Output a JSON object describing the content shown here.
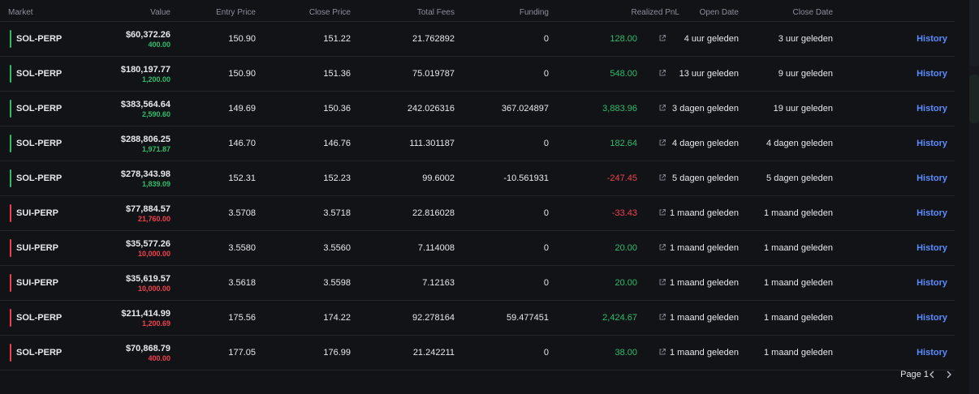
{
  "headers": {
    "market": "Market",
    "value": "Value",
    "entry": "Entry Price",
    "close": "Close Price",
    "fees": "Total Fees",
    "funding": "Funding",
    "pnl": "Realized PnL",
    "open_date": "Open Date",
    "close_date": "Close Date"
  },
  "colors": {
    "positive": "#2fbd6b",
    "negative": "#f0414c",
    "link": "#5b8cff"
  },
  "icons": {
    "external": "external-link-icon",
    "prev": "chevron-left-icon",
    "next": "chevron-right-icon"
  },
  "rows": [
    {
      "market": "SOL-PERP",
      "side": "long",
      "value": "$60,372.26",
      "size": "400.00",
      "entry": "150.90",
      "close": "151.22",
      "fees": "21.762892",
      "funding": "0",
      "pnl": "128.00",
      "pnl_sign": "pos",
      "open_date": "4 uur geleden",
      "close_date": "3 uur geleden",
      "action": "History"
    },
    {
      "market": "SOL-PERP",
      "side": "long",
      "value": "$180,197.77",
      "size": "1,200.00",
      "entry": "150.90",
      "close": "151.36",
      "fees": "75.019787",
      "funding": "0",
      "pnl": "548.00",
      "pnl_sign": "pos",
      "open_date": "13 uur geleden",
      "close_date": "9 uur geleden",
      "action": "History"
    },
    {
      "market": "SOL-PERP",
      "side": "long",
      "value": "$383,564.64",
      "size": "2,590.60",
      "entry": "149.69",
      "close": "150.36",
      "fees": "242.026316",
      "funding": "367.024897",
      "pnl": "3,883.96",
      "pnl_sign": "pos",
      "open_date": "3 dagen geleden",
      "close_date": "19 uur geleden",
      "action": "History"
    },
    {
      "market": "SOL-PERP",
      "side": "long",
      "value": "$288,806.25",
      "size": "1,971.87",
      "entry": "146.70",
      "close": "146.76",
      "fees": "111.301187",
      "funding": "0",
      "pnl": "182.64",
      "pnl_sign": "pos",
      "open_date": "4 dagen geleden",
      "close_date": "4 dagen geleden",
      "action": "History"
    },
    {
      "market": "SOL-PERP",
      "side": "long",
      "value": "$278,343.98",
      "size": "1,839.09",
      "entry": "152.31",
      "close": "152.23",
      "fees": "99.6002",
      "funding": "-10.561931",
      "pnl": "-247.45",
      "pnl_sign": "neg",
      "open_date": "5 dagen geleden",
      "close_date": "5 dagen geleden",
      "action": "History"
    },
    {
      "market": "SUI-PERP",
      "side": "short",
      "value": "$77,884.57",
      "size": "21,760.00",
      "entry": "3.5708",
      "close": "3.5718",
      "fees": "22.816028",
      "funding": "0",
      "pnl": "-33.43",
      "pnl_sign": "neg",
      "open_date": "1 maand geleden",
      "close_date": "1 maand geleden",
      "action": "History"
    },
    {
      "market": "SUI-PERP",
      "side": "short",
      "value": "$35,577.26",
      "size": "10,000.00",
      "entry": "3.5580",
      "close": "3.5560",
      "fees": "7.114008",
      "funding": "0",
      "pnl": "20.00",
      "pnl_sign": "pos",
      "open_date": "1 maand geleden",
      "close_date": "1 maand geleden",
      "action": "History"
    },
    {
      "market": "SUI-PERP",
      "side": "short",
      "value": "$35,619.57",
      "size": "10,000.00",
      "entry": "3.5618",
      "close": "3.5598",
      "fees": "7.12163",
      "funding": "0",
      "pnl": "20.00",
      "pnl_sign": "pos",
      "open_date": "1 maand geleden",
      "close_date": "1 maand geleden",
      "action": "History"
    },
    {
      "market": "SOL-PERP",
      "side": "short",
      "value": "$211,414.99",
      "size": "1,200.69",
      "entry": "175.56",
      "close": "174.22",
      "fees": "92.278164",
      "funding": "59.477451",
      "pnl": "2,424.67",
      "pnl_sign": "pos",
      "open_date": "1 maand geleden",
      "close_date": "1 maand geleden",
      "action": "History"
    },
    {
      "market": "SOL-PERP",
      "side": "short",
      "value": "$70,868.79",
      "size": "400.00",
      "entry": "177.05",
      "close": "176.99",
      "fees": "21.242211",
      "funding": "0",
      "pnl": "38.00",
      "pnl_sign": "pos",
      "open_date": "1 maand geleden",
      "close_date": "1 maand geleden",
      "action": "History"
    }
  ],
  "pagination": {
    "label": "Page 1"
  }
}
